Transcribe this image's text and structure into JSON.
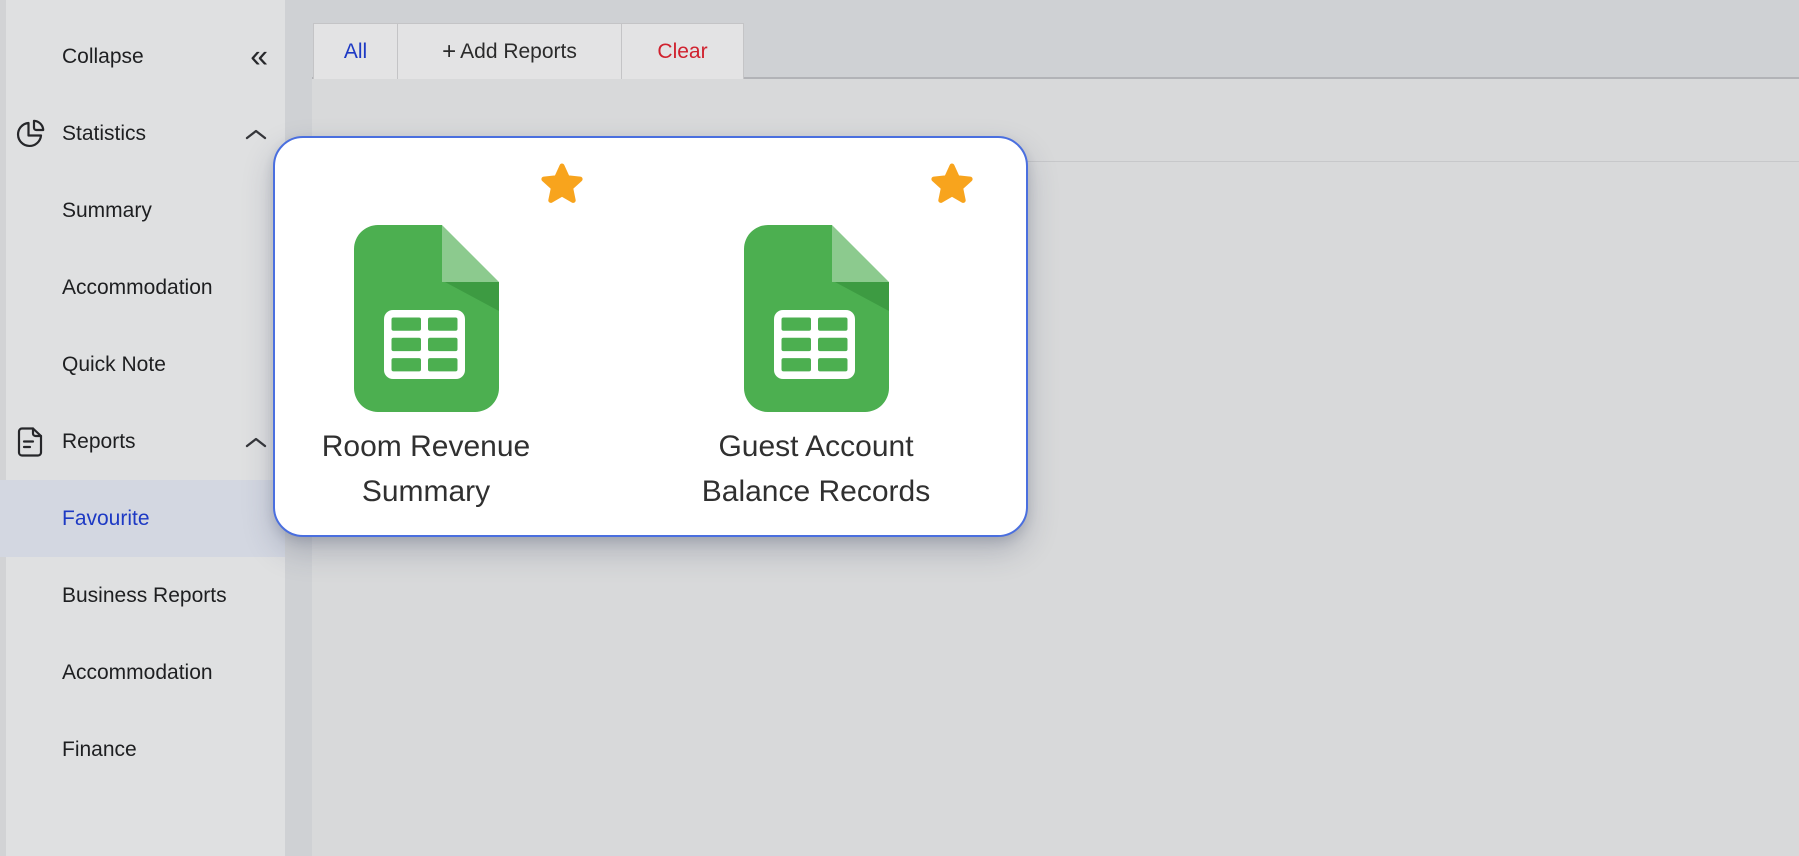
{
  "sidebar": {
    "items": [
      {
        "label": "Collapse",
        "icon": "collapse-chevrons"
      },
      {
        "label": "Statistics",
        "icon": "pie-chart",
        "expanded": true
      },
      {
        "label": "Summary"
      },
      {
        "label": "Accommodation"
      },
      {
        "label": "Quick Note"
      },
      {
        "label": "Reports",
        "icon": "document",
        "expanded": true
      },
      {
        "label": "Favourite",
        "active": true
      },
      {
        "label": "Business Reports"
      },
      {
        "label": "Accommodation"
      },
      {
        "label": "Finance"
      }
    ]
  },
  "tabs": [
    {
      "label": "All",
      "active": true,
      "color": "#1d39c4"
    },
    {
      "label": "Add Reports",
      "prefix": "+"
    },
    {
      "label": "Clear",
      "color": "#d0212e"
    }
  ],
  "favourites_card": {
    "tiles": [
      {
        "title": "Room Revenue Summary",
        "icon": "spreadsheet",
        "starred": true
      },
      {
        "title": "Guest Account Balance Records",
        "icon": "spreadsheet",
        "starred": true
      }
    ]
  },
  "icons": {
    "collapse_glyph": "«"
  },
  "colors": {
    "accent_blue": "#1d39c4",
    "card_border_blue": "#4a6fdf",
    "star_orange": "#f8a41d",
    "sheet_green": "#4caf50",
    "sheet_green_light": "#8cca8e",
    "sheet_green_shadow": "#3d9b42",
    "clear_red": "#d0212e",
    "favourite_row_bg": "#d3d7e1",
    "sidebar_bg": "#dfe0e1",
    "main_bg": "#d8d9da"
  }
}
